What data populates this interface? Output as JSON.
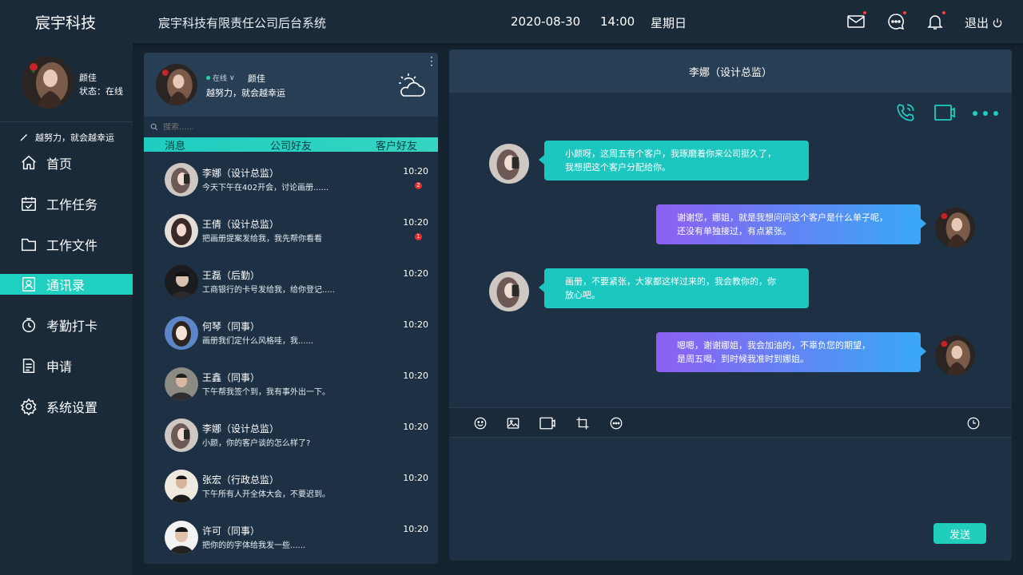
{
  "header": {
    "logo": "宸宇科技",
    "system_title": "宸宇科技有限责任公司后台系统",
    "date": "2020-08-30",
    "time": "14:00",
    "weekday": "星期日",
    "logout": "退出",
    "icons": [
      "mail-icon",
      "chat-bubble-icon",
      "bell-icon",
      "power-icon"
    ]
  },
  "sidebar": {
    "user_name": "颜佳",
    "status": "状态：在线",
    "motto": "越努力，就会越幸运",
    "items": [
      {
        "label": "首页",
        "icon": "home-icon"
      },
      {
        "label": "工作任务",
        "icon": "calendar-icon"
      },
      {
        "label": "工作文件",
        "icon": "folder-icon"
      },
      {
        "label": "通讯录",
        "icon": "contacts-icon"
      },
      {
        "label": "考勤打卡",
        "icon": "clock-icon"
      },
      {
        "label": "申请",
        "icon": "document-icon"
      },
      {
        "label": "系统设置",
        "icon": "gear-icon"
      }
    ],
    "active_index": 3
  },
  "contacts": {
    "profile": {
      "status": "在线",
      "name": "颜佳",
      "motto": "越努力，就会越幸运"
    },
    "search_placeholder": "搜索......",
    "tabs": [
      "消息",
      "公司好友",
      "客户好友"
    ],
    "rows": [
      {
        "name": "李娜（设计总监）",
        "message": "今天下午在402开会，讨论画册......",
        "time": "10:20",
        "badge": "2"
      },
      {
        "name": "王倩（设计总监）",
        "message": "把画册提案发给我，我先帮你看看",
        "time": "10:20",
        "badge": "1"
      },
      {
        "name": "王磊（后勤）",
        "message": "工商银行的卡号发给我，给你登记.....",
        "time": "10:20",
        "badge": ""
      },
      {
        "name": "何琴（同事）",
        "message": "画册我们定什么风格哇，我......",
        "time": "10:20",
        "badge": ""
      },
      {
        "name": "王鑫（同事）",
        "message": "下午帮我签个到，我有事外出一下。",
        "time": "10:20",
        "badge": ""
      },
      {
        "name": "李娜（设计总监）",
        "message": "小颜，你的客户谈的怎么样了?",
        "time": "10:20",
        "badge": ""
      },
      {
        "name": "张宏（行政总监）",
        "message": "下午所有人开全体大会，不要迟到。",
        "time": "10:20",
        "badge": ""
      },
      {
        "name": "许可（同事）",
        "message": "把你的的字体给我发一些......",
        "time": "10:20",
        "badge": ""
      }
    ]
  },
  "chat": {
    "title": "李娜（设计总监）",
    "messages": [
      {
        "side": "left",
        "line1": "小颜呀，这周五有个客户，我琢磨着你来公司挺久了，",
        "line2": "我想把这个客户分配给你。"
      },
      {
        "side": "right",
        "line1": "谢谢您，娜姐，就是我想问问这个客户是什么单子呢，",
        "line2": "还没有单独接过，有点紧张。"
      },
      {
        "side": "left",
        "line1": "画册，不要紧张，大家都这样过来的，我会教你的，你",
        "line2": "放心吧。"
      },
      {
        "side": "right",
        "line1": "嗯嗯，谢谢娜姐，我会加油的，不辜负您的期望，",
        "line2": "是周五喝，到时候我准时到娜姐。"
      }
    ],
    "send_label": "发送"
  },
  "colors": {
    "accent": "#1fcfc0",
    "panel": "#1e3044",
    "background": "#15222f",
    "bubble_left": "#1cc7c0",
    "bubble_right_start": "#8d5ff2",
    "bubble_right_end": "#38a8f5",
    "badge": "#ef2b2b"
  }
}
